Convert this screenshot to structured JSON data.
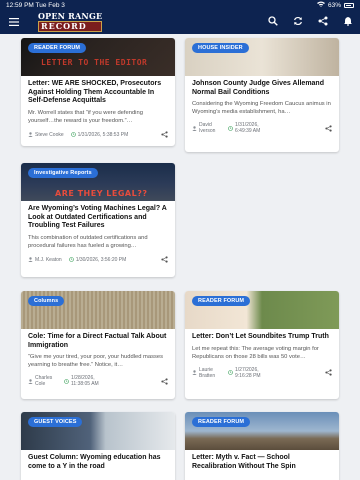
{
  "status": {
    "time": "12:59 PM",
    "date": "Tue Feb 3",
    "battery": "63%"
  },
  "brand": {
    "line1": "OPEN RANGE",
    "line2": "RECORD"
  },
  "colors": {
    "header": "#0d2350",
    "badge": "#2b6fd6"
  },
  "articles": [
    {
      "category": "READER FORUM",
      "image_text": "LETTER TO THE EDITOR",
      "title": "Letter: WE ARE SHOCKED, Prosecutors Against Holding Them Accountable In Self-Defense Acquittals",
      "excerpt": "Mr. Worrell states that “if you were defending yourself…the reward is your freedom.”…",
      "author": "Steve Cooke",
      "timestamp": "1/31/2026, 5:38:53 PM"
    },
    {
      "category": "HOUSE INSIDER",
      "title": "Johnson County Judge Gives Allemand Normal Bail Conditions",
      "excerpt": "Considering the Wyoming Freedom Caucus animus in Wyoming’s media establishment, ha…",
      "author": "David Iverson",
      "timestamp": "1/31/2026, 6:49:39 AM"
    },
    {
      "category": "Investigative Reports",
      "image_text": "ARE THEY LEGAL??",
      "title": "Are Wyoming’s Voting Machines Legal? A Look at Outdated Certifications and Troubling Test Failures",
      "excerpt": "This combination of outdated certifications and procedural failures has fueled a growing…",
      "author": "M.J. Keaton",
      "timestamp": "1/30/2026, 3:56:20 PM"
    },
    {
      "category": "Columns",
      "title": "Cole: Time for a Direct Factual Talk About Immigration",
      "excerpt": "“Give me your tired, your poor, your huddled masses yearning to breathe free.” Notice, it…",
      "author": "Charles Cole",
      "timestamp": "1/28/2026, 11:38:05 AM"
    },
    {
      "category": "READER FORUM",
      "title": "Letter: Don’t Let Soundbites Trump Truth",
      "excerpt": "Let me repeat this: The average voting margin for Republicans on those 28 bills was 50 vote…",
      "author": "Laurie Bratten",
      "timestamp": "1/27/2026, 9:16:28 PM"
    },
    {
      "category": "GUEST VOICES",
      "title": "Guest Column: Wyoming education has come to a Y in the road",
      "excerpt": "",
      "author": "",
      "timestamp": ""
    },
    {
      "category": "READER FORUM",
      "title": "Letter: Myth v. Fact — School Recalibration Without The Spin",
      "excerpt": "",
      "author": "",
      "timestamp": ""
    }
  ]
}
